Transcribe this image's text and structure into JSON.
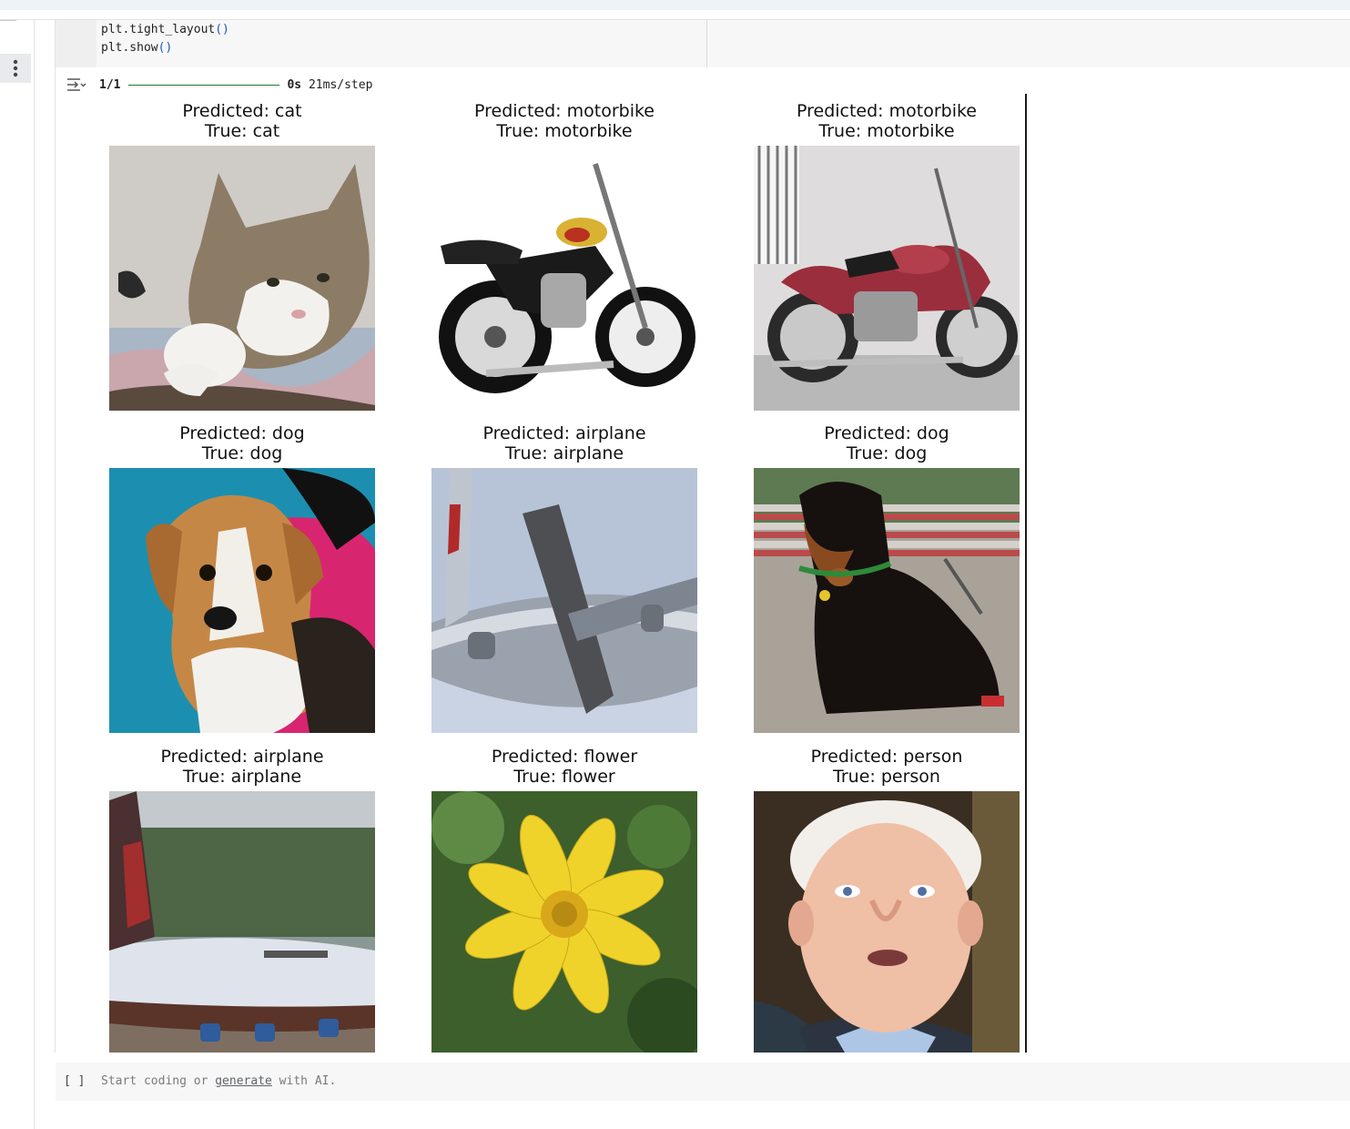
{
  "code": {
    "lines": [
      "plt.tight_layout",
      "plt.show"
    ],
    "paren": "()"
  },
  "progress": {
    "step": "1/1",
    "time": "0s",
    "rate": "21ms/step"
  },
  "subplots": [
    {
      "predicted": "Predicted: cat",
      "true": "True: cat",
      "image": "cat-photo"
    },
    {
      "predicted": "Predicted: motorbike",
      "true": "True: motorbike",
      "image": "motorbike-photo"
    },
    {
      "predicted": "Predicted: motorbike",
      "true": "True: motorbike",
      "image": "motorbike-photo"
    },
    {
      "predicted": "Predicted: dog",
      "true": "True: dog",
      "image": "dog-photo"
    },
    {
      "predicted": "Predicted: airplane",
      "true": "True: airplane",
      "image": "airplane-photo"
    },
    {
      "predicted": "Predicted: dog",
      "true": "True: dog",
      "image": "dog-photo"
    },
    {
      "predicted": "Predicted: airplane",
      "true": "True: airplane",
      "image": "airplane-photo"
    },
    {
      "predicted": "Predicted: flower",
      "true": "True: flower",
      "image": "flower-photo"
    },
    {
      "predicted": "Predicted: person",
      "true": "True: person",
      "image": "person-photo"
    }
  ],
  "new_cell": {
    "brackets": "[ ]",
    "placeholder_before": "Start coding or ",
    "placeholder_link": "generate",
    "placeholder_after": " with AI."
  },
  "icons": {
    "more": "more-vert-icon",
    "output": "output-toggle-icon"
  }
}
